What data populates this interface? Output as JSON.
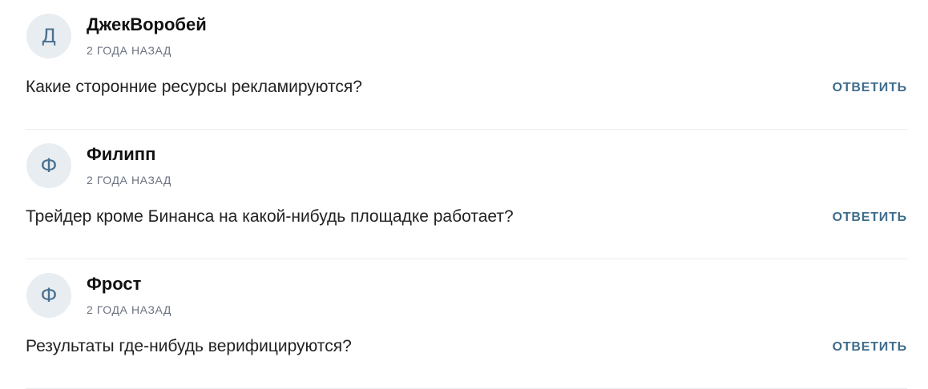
{
  "comments": [
    {
      "avatar_letter": "Д",
      "author": "ДжекВоробей",
      "time": "2 ГОДА НАЗАД",
      "text": "Какие сторонние ресурсы рекламируются?",
      "reply_label": "ОТВЕТИТЬ"
    },
    {
      "avatar_letter": "Ф",
      "author": "Филипп",
      "time": "2 ГОДА НАЗАД",
      "text": "Трейдер кроме Бинанса на какой-нибудь площадке работает?",
      "reply_label": "ОТВЕТИТЬ"
    },
    {
      "avatar_letter": "Ф",
      "author": "Фрост",
      "time": "2 ГОДА НАЗАД",
      "text": "Результаты где-нибудь верифицируются?",
      "reply_label": "ОТВЕТИТЬ"
    }
  ],
  "colors": {
    "accent": "#3f6d8c",
    "avatar_bg": "#e8edf2",
    "divider": "#e9ecef"
  }
}
